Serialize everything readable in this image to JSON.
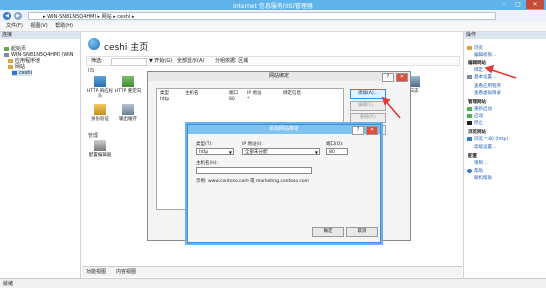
{
  "window": {
    "title": "Internet 信息服务(IIS)管理器",
    "minimize": "–",
    "maximize": "□",
    "close": "✕"
  },
  "address": {
    "path": "▸ WIN-SN81N5Q4HMI ▸ 网站 ▸ ceshi ▸"
  },
  "menu": {
    "file": "文件(F)",
    "view": "视图(V)",
    "help": "帮助(H)"
  },
  "left": {
    "header": "连接",
    "tree": [
      "起始页",
      "WIN-SN81N5Q4HMI (WIN",
      "应用程序池",
      "网站",
      "ceshi"
    ]
  },
  "main": {
    "title": "ceshi 主页",
    "filter_label": "筛选:",
    "filter_go": "▼ 开始(G)",
    "filter_showall": "全部显示(A)",
    "filter_group": "分组依据: 区域",
    "group_iis": "IIS",
    "features": [
      "HTTP 响应标头",
      "HTTP 重定向",
      "身份验证",
      "输出缓存",
      "日志"
    ],
    "group_mgmt": "管理",
    "features_mgmt": [
      "配置编辑器"
    ],
    "view_features": "功能视图",
    "view_content": "内容视图"
  },
  "actions": {
    "header": "操作",
    "explore": "浏览",
    "edit_perms": "编辑权限...",
    "edit_site_head": "编辑网站",
    "bindings": "绑定...",
    "basic_settings": "基本设置...",
    "view_apps": "查看应用程序",
    "view_vdirs": "查看虚拟目录",
    "manage_site_head": "管理网站",
    "restart": "重新启动",
    "start": "启动",
    "stop": "停止",
    "browse_head": "浏览网站",
    "browse_80": "浏览 *:80 (http)",
    "advanced": "高级设置...",
    "config_head": "配置",
    "limits": "限制...",
    "help": "帮助",
    "online_help": "联机帮助"
  },
  "status": {
    "text": "就绪"
  },
  "site_bindings": {
    "title": "网站绑定",
    "help_btn": "?",
    "close_btn": "✕",
    "columns": [
      "类型",
      "主机名",
      "端口",
      "IP 地址",
      "绑定信息"
    ],
    "rows": [
      [
        "http",
        "",
        "80",
        "*",
        ""
      ]
    ],
    "add": "添加(A)...",
    "edit": "编辑(E)...",
    "remove": "删除(R)",
    "browse": "浏览(B)"
  },
  "add_binding": {
    "title": "添加网站绑定",
    "help_btn": "?",
    "close_btn": "✕",
    "type_label": "类型(T):",
    "type_value": "http",
    "ip_label": "IP 地址(I):",
    "ip_value": "全部未分配",
    "port_label": "端口(O):",
    "port_value": "80",
    "host_label": "主机名(H):",
    "host_value": "",
    "example": "示例: www.contoso.com 或 marketing.contoso.com",
    "ok": "确定",
    "cancel": "取消"
  },
  "colors": {
    "accent": "#5fb3e8",
    "arrow": "#e53935",
    "dialog_border": "#3b8fd6"
  }
}
